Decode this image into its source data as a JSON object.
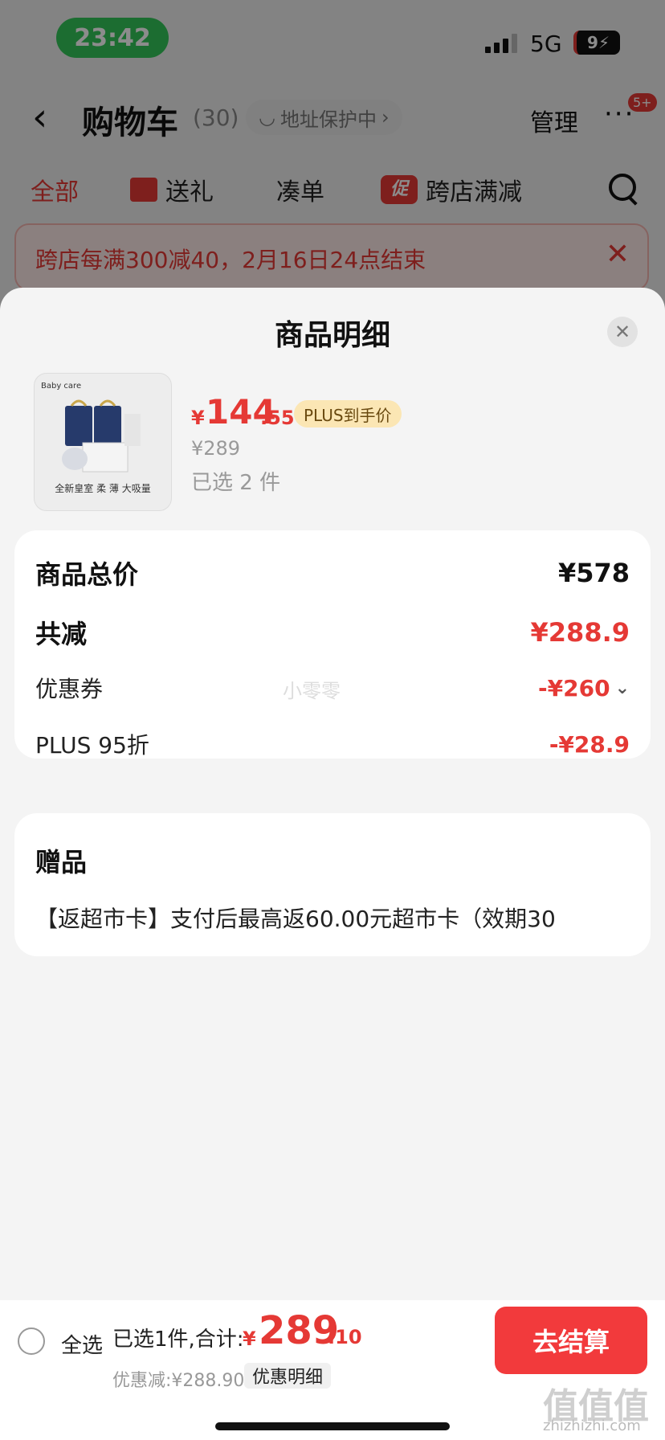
{
  "status_bar": {
    "time": "23:42",
    "network": "5G",
    "battery": "9"
  },
  "header": {
    "title": "购物车",
    "count": "(30)",
    "address": "地址保护中",
    "manage": "管理",
    "more_badge": "5+"
  },
  "tabs": [
    "全部",
    "送礼",
    "凑单",
    "跨店满减"
  ],
  "promo_icon_text": "促",
  "promo_banner": "跨店每满300减40，2月16日24点结束",
  "sheet": {
    "title": "商品明细",
    "product": {
      "image_slogan": "全新皇室 柔 薄 大吸量",
      "image_logo": "Baby care",
      "price_currency": "¥",
      "price_int": "144",
      "price_dec": ".55",
      "plus_tag": "PLUS到手价",
      "original_price": "¥289",
      "selected": "已选 2 件"
    },
    "summary": {
      "total_label": "商品总价",
      "total_value": "¥578",
      "reduce_label": "共减",
      "reduce_value": "¥288.9",
      "coupon_label": "优惠券",
      "coupon_value": "-¥260",
      "plus_label": "PLUS 95折",
      "plus_value": "-¥28.9",
      "watermark": "小零零"
    },
    "gift": {
      "title": "赠品",
      "item": "【返超市卡】支付后最高返60.00元超市卡（效期30"
    }
  },
  "bottom_bar": {
    "select_all": "全选",
    "summary_text": "已选1件,合计:",
    "total_currency": "¥",
    "total_int": "289",
    "total_dec": ".10",
    "discount": "优惠减:¥288.90",
    "detail_button": "优惠明细",
    "checkout": "去结算"
  },
  "watermark_site": {
    "mark": "值值值",
    "url": "zhizhizhi.com"
  },
  "colors": {
    "accent": "#e53935",
    "checkout": "#f23a3c",
    "plus_tag": "#fbe6b4",
    "status_pill": "#34c759"
  }
}
